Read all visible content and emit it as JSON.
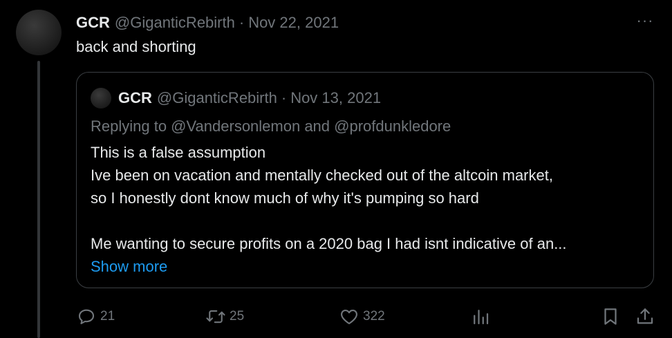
{
  "tweet": {
    "author_name": "GCR",
    "author_handle": "@GiganticRebirth",
    "separator": "·",
    "date": "Nov 22, 2021",
    "text": "back and shorting",
    "more_label": "···"
  },
  "quote": {
    "author_name": "GCR",
    "author_handle": "@GiganticRebirth",
    "separator": "·",
    "date": "Nov 13, 2021",
    "replying_to": "Replying to @Vandersonlemon and @profdunkledore",
    "lines": [
      "This is a false assumption",
      "Ive been on vacation and mentally checked out of the altcoin market,",
      "so I honestly dont know much of why it's pumping so hard",
      "Me wanting to secure profits on a 2020 bag I had isnt indicative of an..."
    ],
    "show_more": "Show more"
  },
  "actions": {
    "reply_count": "21",
    "retweet_count": "25",
    "like_count": "322",
    "icons": [
      "reply-icon",
      "retweet-icon",
      "like-icon",
      "views-icon",
      "bookmark-icon",
      "share-icon"
    ]
  },
  "colors": {
    "background": "#000000",
    "text": "#e7e9ea",
    "muted": "#71767b",
    "link": "#1d9bf0",
    "border": "#3b3f43"
  }
}
